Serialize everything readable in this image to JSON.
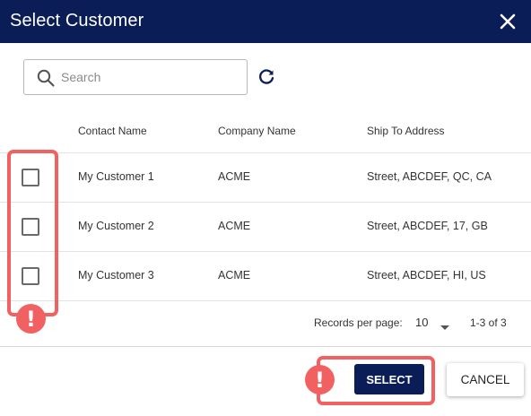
{
  "dialog": {
    "title": "Select Customer",
    "close_icon": "close-icon"
  },
  "search": {
    "placeholder": "Search",
    "value": "",
    "icon": "search-icon"
  },
  "refresh_icon": "refresh-icon",
  "table": {
    "columns": [
      "Contact Name",
      "Company Name",
      "Ship To Address"
    ],
    "rows": [
      {
        "checked": false,
        "contact": "My Customer 1",
        "company": "ACME",
        "address": "Street, ABCDEF, QC, CA"
      },
      {
        "checked": false,
        "contact": "My Customer 2",
        "company": "ACME",
        "address": "Street, ABCDEF, 17, GB"
      },
      {
        "checked": false,
        "contact": "My Customer 3",
        "company": "ACME",
        "address": "Street, ABCDEF, HI, US"
      }
    ]
  },
  "pagination": {
    "records_per_page_label": "Records per page:",
    "records_per_page_value": "10",
    "range": "1-3 of 3"
  },
  "actions": {
    "select_label": "SELECT",
    "cancel_label": "CANCEL"
  },
  "annotations": {
    "alert_symbol": "!",
    "color": "#f26161"
  },
  "colors": {
    "header_bg": "#0b1d56",
    "primary_button": "#0b1d56"
  }
}
